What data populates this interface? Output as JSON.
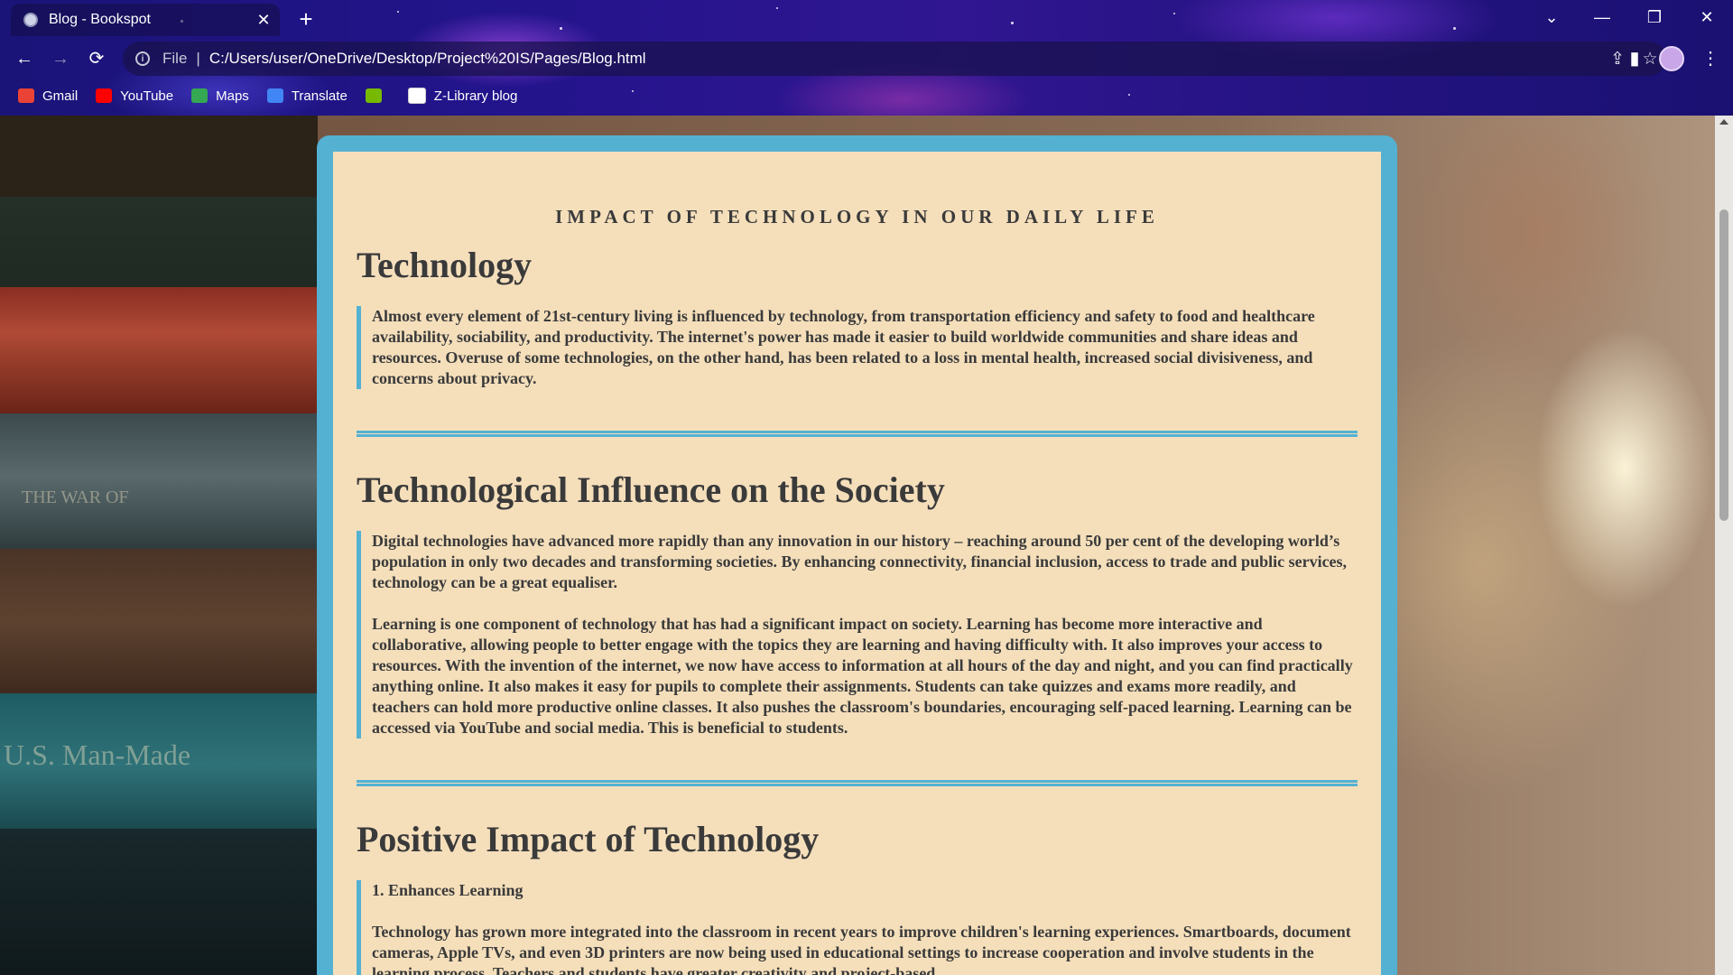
{
  "browser": {
    "tab_title": "Blog - Bookspot",
    "address_scheme": "File",
    "address_url": "C:/Users/user/OneDrive/Desktop/Project%20IS/Pages/Blog.html",
    "bookmarks": [
      {
        "label": "Gmail",
        "icon": "gmail-icon",
        "color": "#ea4335"
      },
      {
        "label": "YouTube",
        "icon": "youtube-icon",
        "color": "#ff0000"
      },
      {
        "label": "Maps",
        "icon": "maps-icon",
        "color": "#34a853"
      },
      {
        "label": "Translate",
        "icon": "translate-icon",
        "color": "#4285f4"
      },
      {
        "label": "",
        "icon": "nvidia-icon",
        "color": "#76b900"
      },
      {
        "label": "Z-Library blog",
        "icon": "zlibrary-icon",
        "color": "#ffffff"
      }
    ],
    "controls": {
      "back": "←",
      "forward": "→",
      "reload": "⟳",
      "new_tab": "+",
      "close_tab": "✕",
      "tab_search": "⌄",
      "minimize": "—",
      "restore": "❐",
      "close": "✕",
      "share": "⇪",
      "star": "☆",
      "side_panel": "▮",
      "menu": "⋮",
      "info": "i"
    }
  },
  "page": {
    "background_accent": "#54b1d2",
    "card_color": "#f5dfbb",
    "heading": "IMPACT OF TECHNOLOGY IN OUR DAILY LIFE",
    "sections": [
      {
        "title": "Technology",
        "paragraphs": [
          "Almost every element of 21st-century living is influenced by technology, from transportation efficiency and safety to food and healthcare availability, sociability, and productivity. The internet's power has made it easier to build worldwide communities and share ideas and resources. Overuse of some technologies, on the other hand, has been related to a loss in mental health, increased social divisiveness, and concerns about privacy."
        ]
      },
      {
        "title": "Technological Influence on the Society",
        "paragraphs": [
          "Digital technologies have advanced more rapidly than any innovation in our history – reaching around 50 per cent of the developing world’s population in only two decades and transforming societies. By enhancing connectivity, financial inclusion, access to trade and public services, technology can be a great equaliser.",
          "Learning is one component of technology that has had a significant impact on society. Learning has become more interactive and collaborative, allowing people to better engage with the topics they are learning and having difficulty with. It also improves your access to resources. With the invention of the internet, we now have access to information at all hours of the day and night, and you can find practically anything online. It also makes it easy for pupils to complete their assignments. Students can take quizzes and exams more readily, and teachers can hold more productive online classes. It also pushes the classroom's boundaries, encouraging self-paced learning. Learning can be accessed via YouTube and social media. This is beneficial to students."
        ]
      },
      {
        "title": "Positive Impact of Technology",
        "paragraphs": [
          "1. Enhances Learning",
          "Technology has grown more integrated into the classroom in recent years to improve children's learning experiences. Smartboards, document cameras, Apple TVs, and even 3D printers are now being used in educational settings to increase cooperation and involve students in the learning process. Teachers and students have greater creativity and project-based"
        ]
      }
    ]
  }
}
